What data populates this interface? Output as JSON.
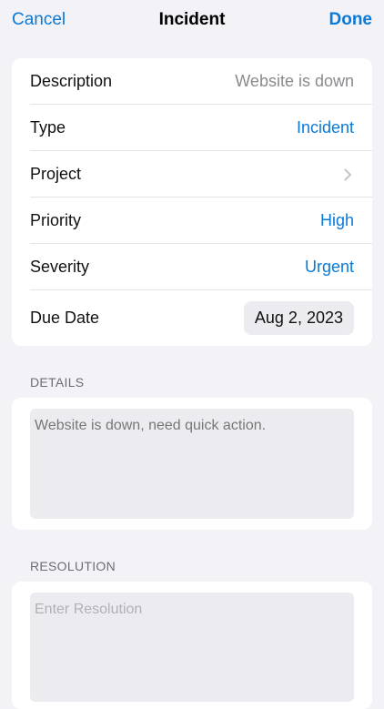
{
  "nav": {
    "cancel_label": "Cancel",
    "title": "Incident",
    "done_label": "Done"
  },
  "form": {
    "description": {
      "label": "Description",
      "value": "Website is down"
    },
    "type": {
      "label": "Type",
      "value": "Incident"
    },
    "project": {
      "label": "Project",
      "icon": "chevron-right-icon"
    },
    "priority": {
      "label": "Priority",
      "value": "High"
    },
    "severity": {
      "label": "Severity",
      "value": "Urgent"
    },
    "due_date": {
      "label": "Due Date",
      "value": "Aug 2, 2023"
    }
  },
  "details": {
    "header": "DETAILS",
    "text": "Website is down, need quick action."
  },
  "resolution": {
    "header": "RESOLUTION",
    "placeholder": "Enter Resolution"
  },
  "colors": {
    "accent": "#0a7ad8",
    "background": "#f2f2f7",
    "card": "#ffffff",
    "field": "#ececf0"
  }
}
